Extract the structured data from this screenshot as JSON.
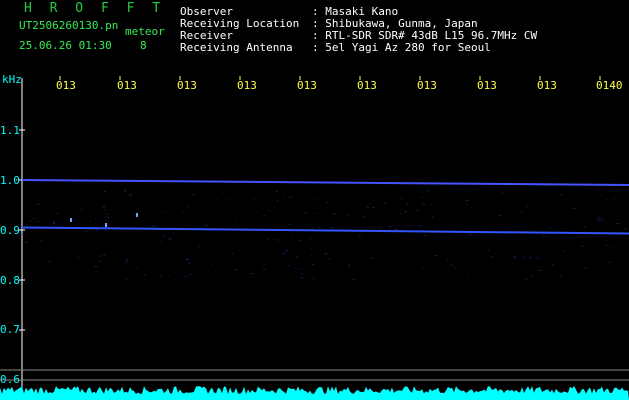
{
  "app": {
    "title": "H R O F F T",
    "filename": "UT2506260130.pn",
    "mode": "meteor",
    "datetime": "25.06.26 01:30",
    "counter": "8"
  },
  "info": {
    "labels": [
      "Observer",
      "Receiving Location",
      "Receiver",
      "Receiving Antenna"
    ],
    "values": [
      ": Masaki Kano",
      ": Shibukawa, Gunma, Japan",
      ": RTL-SDR SDR# 43dB L15 96.7MHz CW",
      ": 5el Yagi Az 280 for Seoul"
    ]
  },
  "spectrogram": {
    "freq_unit": "kHz",
    "y_ticks": [
      "1.1",
      "1.0",
      "0.9",
      "0.8",
      "0.7",
      "0.6"
    ],
    "time_ticks": [
      "013",
      "013",
      "013",
      "013",
      "013",
      "013",
      "013",
      "013",
      "013",
      "0140"
    ],
    "traces": [
      {
        "name": "upper-carrier",
        "from_khz": 1.0,
        "to_khz": 0.99,
        "color": "#4455ff"
      },
      {
        "name": "lower-carrier",
        "from_khz": 0.905,
        "to_khz": 0.893,
        "color": "#3355ff"
      }
    ],
    "colors": {
      "axis": "#ffffff",
      "trace": "#3344ff",
      "strip": "#00ffff",
      "time_labels": "#ffff44"
    }
  }
}
